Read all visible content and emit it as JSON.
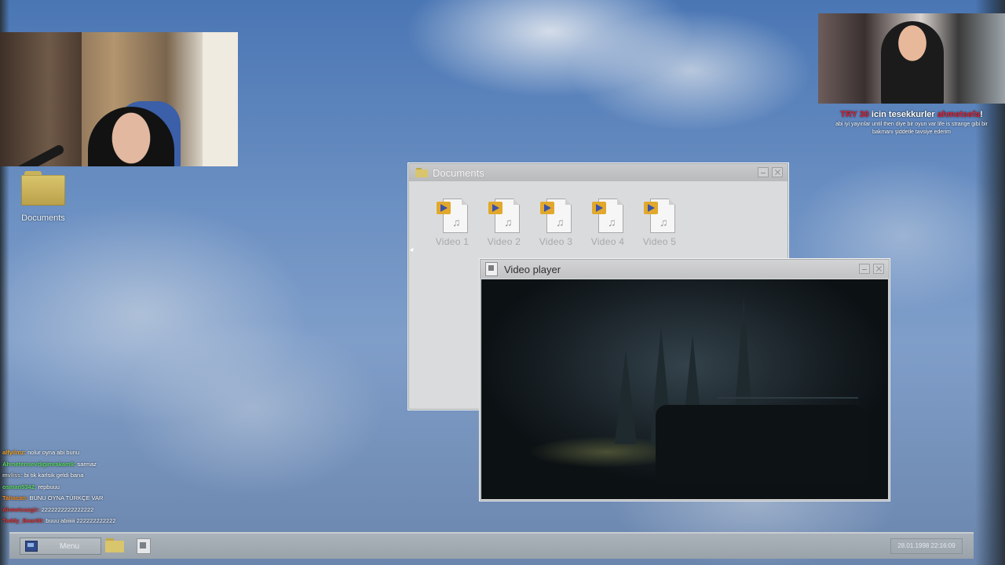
{
  "desktop": {
    "icons": [
      {
        "label": "Documents",
        "icon": "folder-icon"
      }
    ]
  },
  "documents_window": {
    "title": "Documents",
    "files": [
      {
        "label": "Video 1",
        "icon": "video-file-icon"
      },
      {
        "label": "Video 2",
        "icon": "video-file-icon"
      },
      {
        "label": "Video 3",
        "icon": "video-file-icon"
      },
      {
        "label": "Video 4",
        "icon": "video-file-icon"
      },
      {
        "label": "Video 5",
        "icon": "video-file-icon"
      }
    ]
  },
  "player_window": {
    "title": "Video player"
  },
  "alert": {
    "amount": "TRY 30",
    "mid": " icin tesekkurler ",
    "user": "ahmetsefa",
    "end": "!",
    "message": "abi iyi yayınlar until then diye bir oyun var life is strange gibi bir bakmanı şiddetle tavsiye ederim"
  },
  "chat": [
    {
      "user": "alfyilmz:",
      "text": " nolur oyna abi bunu",
      "color": "#f0a020"
    },
    {
      "user": "Ahmetensevdigimrakam9:",
      "text": " sarmaz",
      "color": "#5ad860"
    },
    {
      "user": "mvliss:",
      "text": " bi tik karlsik geldi bana",
      "color": "#c8c8c8"
    },
    {
      "user": "osman5342:",
      "text": " repbuuu",
      "color": "#5ad860"
    },
    {
      "user": "Tahacan:",
      "text": " BUNU OYNA TÜRKÇE VAR",
      "color": "#f08a20"
    },
    {
      "user": "Ahmetcazgir:",
      "text": " 2222222222222222",
      "color": "#d83030"
    },
    {
      "user": "Teddy_Bear00:",
      "text": " buuu abiiiiii 222222222222",
      "color": "#d83030"
    }
  ],
  "taskbar": {
    "menu_label": "Menu",
    "clock": "28.01.1998 22:16:09"
  },
  "colors": {
    "alert_accent": "#d8243a",
    "desktop_sky": "#6a8fc2"
  }
}
